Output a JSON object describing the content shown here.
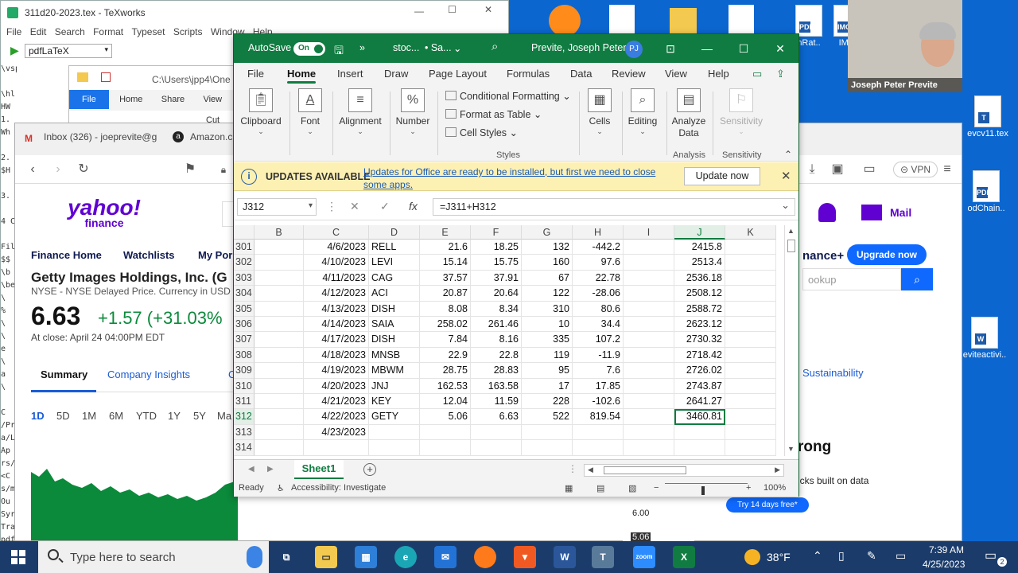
{
  "texworks": {
    "title": "311d20-2023.tex - TeXworks",
    "menu": [
      "File",
      "Edit",
      "Search",
      "Format",
      "Typeset",
      "Scripts",
      "Window",
      "Help"
    ],
    "engine": "pdfLaTeX",
    "editor_lines": [
      "\\vspace{4in}",
      "",
      "\\hl",
      "HW",
      "1.",
      "Wh",
      "",
      "2.",
      "$H",
      "",
      "3.",
      "",
      "4 C",
      "",
      "Fill",
      "$$",
      "\\b",
      "\\be",
      "\\",
      "%",
      "\\",
      "\\",
      "e",
      "\\",
      "a",
      "\\",
      "",
      "C",
      "/Pr",
      "a/L",
      "Ap",
      "rs/j",
      "<C",
      "s/m",
      "Ou",
      "Syr",
      "Tra",
      "pdf"
    ]
  },
  "explorer": {
    "path": "C:\\Users\\jpp4\\One",
    "tabs": [
      "File",
      "Home",
      "Share",
      "View"
    ],
    "items": [
      "Cut"
    ]
  },
  "browser": {
    "tabs": [
      "Inbox (326) - joeprevite@g",
      "Amazon.c"
    ],
    "yahoo_logo_top": "yahoo!",
    "yahoo_logo_bottom": "finance",
    "subnav": [
      "Finance Home",
      "Watchlists",
      "My Por"
    ],
    "company": "Getty Images Holdings, Inc. (G",
    "exchange": "NYSE - NYSE Delayed Price. Currency in USD",
    "price": "6.63",
    "change": "+1.57  (+31.03%",
    "close_time": "At close: April 24 04:00PM EDT",
    "quote_tabs": [
      "Summary",
      "Company Insights",
      "C"
    ],
    "ranges": [
      "1D",
      "5D",
      "1M",
      "6M",
      "YTD",
      "1Y",
      "5Y",
      "Ma"
    ],
    "right": {
      "mail": "Mail",
      "upgrade": "Upgrade now",
      "plus_text": "nance+",
      "search_placeholder": "ookup",
      "sustainability": "Sustainability",
      "promo_title": "rong",
      "promo_sub": "icks built on data",
      "trial": "Try 14 days free*",
      "chart_labels": [
        "6.00",
        "5.06"
      ],
      "vpn": "VPN"
    }
  },
  "zoom": {
    "participant": "Joseph Peter Previte"
  },
  "desktop_icons": [
    {
      "label": "hRat..",
      "badge": "PDF"
    },
    {
      "label": "IMG",
      "badge": "IMG"
    },
    {
      "label": "evcv11.tex",
      "badge": "T"
    },
    {
      "label": "odChain..",
      "badge": "PDF"
    },
    {
      "label": "eviteactivi..",
      "badge": "W"
    }
  ],
  "excel": {
    "autosave_label": "AutoSave",
    "autosave_state": "On",
    "file_name": "stoc...",
    "saved_state": "• Sa...",
    "user": "Previte, Joseph Peter",
    "user_initials": "PJ",
    "menu": [
      "File",
      "Home",
      "Insert",
      "Draw",
      "Page Layout",
      "Formulas",
      "Data",
      "Review",
      "View",
      "Help"
    ],
    "active_tab": "Home",
    "ribbon": {
      "clipboard": "Clipboard",
      "font": "Font",
      "alignment": "Alignment",
      "number": "Number",
      "conditional_formatting": "Conditional Formatting",
      "format_as_table": "Format as Table",
      "cell_styles": "Cell Styles",
      "styles_caption": "Styles",
      "cells": "Cells",
      "editing": "Editing",
      "analyze_data": "Analyze Data",
      "analysis_caption": "Analysis",
      "sensitivity": "Sensitivity",
      "sensitivity_caption": "Sensitivity"
    },
    "update_bar": {
      "title": "UPDATES AVAILABLE",
      "message": "Updates for Office are ready to be installed, but first we need to close some apps.",
      "button": "Update now"
    },
    "name_box": "J312",
    "formula": "=J311+H312",
    "columns": [
      "B",
      "C",
      "D",
      "E",
      "F",
      "G",
      "H",
      "I",
      "J",
      "K"
    ],
    "selected_column": "J",
    "rows": [
      {
        "row": "301",
        "C": "4/6/2023",
        "D": "RELL",
        "E": "21.6",
        "F": "18.25",
        "G": "132",
        "H": "-442.2",
        "J": "2415.8"
      },
      {
        "row": "302",
        "C": "4/10/2023",
        "D": "LEVI",
        "E": "15.14",
        "F": "15.75",
        "G": "160",
        "H": "97.6",
        "J": "2513.4"
      },
      {
        "row": "303",
        "C": "4/11/2023",
        "D": "CAG",
        "E": "37.57",
        "F": "37.91",
        "G": "67",
        "H": "22.78",
        "J": "2536.18"
      },
      {
        "row": "304",
        "C": "4/12/2023",
        "D": "ACI",
        "E": "20.87",
        "F": "20.64",
        "G": "122",
        "H": "-28.06",
        "J": "2508.12"
      },
      {
        "row": "305",
        "C": "4/13/2023",
        "D": "DISH",
        "E": "8.08",
        "F": "8.34",
        "G": "310",
        "H": "80.6",
        "J": "2588.72"
      },
      {
        "row": "306",
        "C": "4/14/2023",
        "D": "SAIA",
        "E": "258.02",
        "F": "261.46",
        "G": "10",
        "H": "34.4",
        "J": "2623.12"
      },
      {
        "row": "307",
        "C": "4/17/2023",
        "D": "DISH",
        "E": "7.84",
        "F": "8.16",
        "G": "335",
        "H": "107.2",
        "J": "2730.32"
      },
      {
        "row": "308",
        "C": "4/18/2023",
        "D": "MNSB",
        "E": "22.9",
        "F": "22.8",
        "G": "119",
        "H": "-11.9",
        "J": "2718.42"
      },
      {
        "row": "309",
        "C": "4/19/2023",
        "D": "MBWM",
        "E": "28.75",
        "F": "28.83",
        "G": "95",
        "H": "7.6",
        "J": "2726.02"
      },
      {
        "row": "310",
        "C": "4/20/2023",
        "D": "JNJ",
        "E": "162.53",
        "F": "163.58",
        "G": "17",
        "H": "17.85",
        "J": "2743.87"
      },
      {
        "row": "311",
        "C": "4/21/2023",
        "D": "KEY",
        "E": "12.04",
        "F": "11.59",
        "G": "228",
        "H": "-102.6",
        "J": "2641.27"
      },
      {
        "row": "312",
        "C": "4/22/2023",
        "D": "GETY",
        "E": "5.06",
        "F": "6.63",
        "G": "522",
        "H": "819.54",
        "J": "3460.81"
      },
      {
        "row": "313",
        "C": "4/23/2023",
        "D": "",
        "E": "",
        "F": "",
        "G": "",
        "H": "",
        "J": ""
      },
      {
        "row": "314",
        "C": "",
        "D": "",
        "E": "",
        "F": "",
        "G": "",
        "H": "",
        "J": ""
      }
    ],
    "sheet_tab": "Sheet1",
    "status": {
      "ready": "Ready",
      "accessibility": "Accessibility: Investigate",
      "zoom": "100%"
    }
  },
  "taskbar": {
    "search_placeholder": "Type here to search",
    "weather": "38°F",
    "time": "7:39 AM",
    "date": "4/25/2023",
    "notifications": "2"
  },
  "colors": {
    "excel_green": "#107c41",
    "desktop_blue": "#0b66cf",
    "yahoo_purple": "#6001d2",
    "positive_green": "#0b8a3b",
    "update_yellow": "#fdf0b3"
  }
}
